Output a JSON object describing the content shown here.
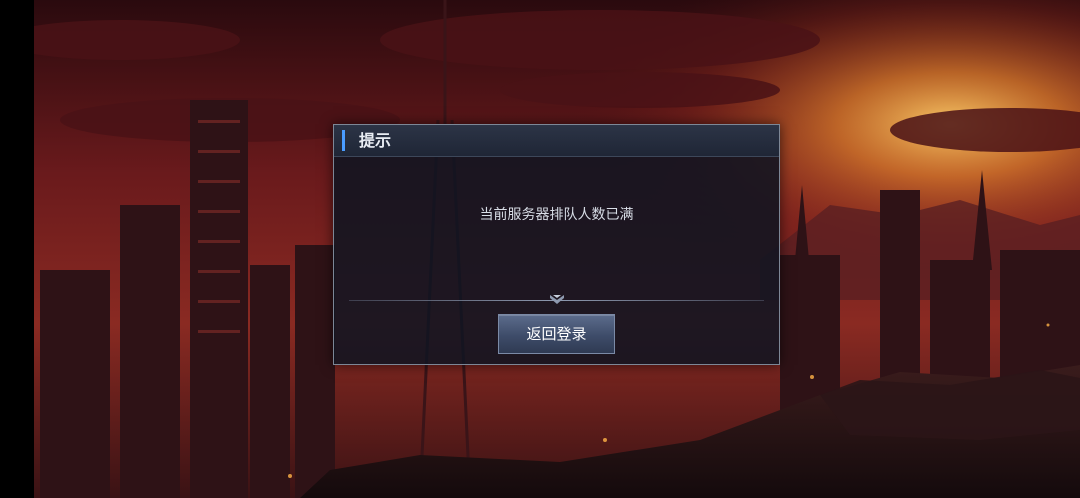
{
  "dialog": {
    "title": "提示",
    "message": "当前服务器排队人数已满",
    "button_label": "返回登录"
  },
  "colors": {
    "accent": "#4a9cff",
    "sky_top": "#3a0c10",
    "sky_glow": "#f0a03c",
    "dialog_bg": "#101521",
    "button_bg": "#3e4c69"
  },
  "icons": {
    "header_marker": "title-accent-bar",
    "divider_ornament": "chevron-down-ornament"
  }
}
